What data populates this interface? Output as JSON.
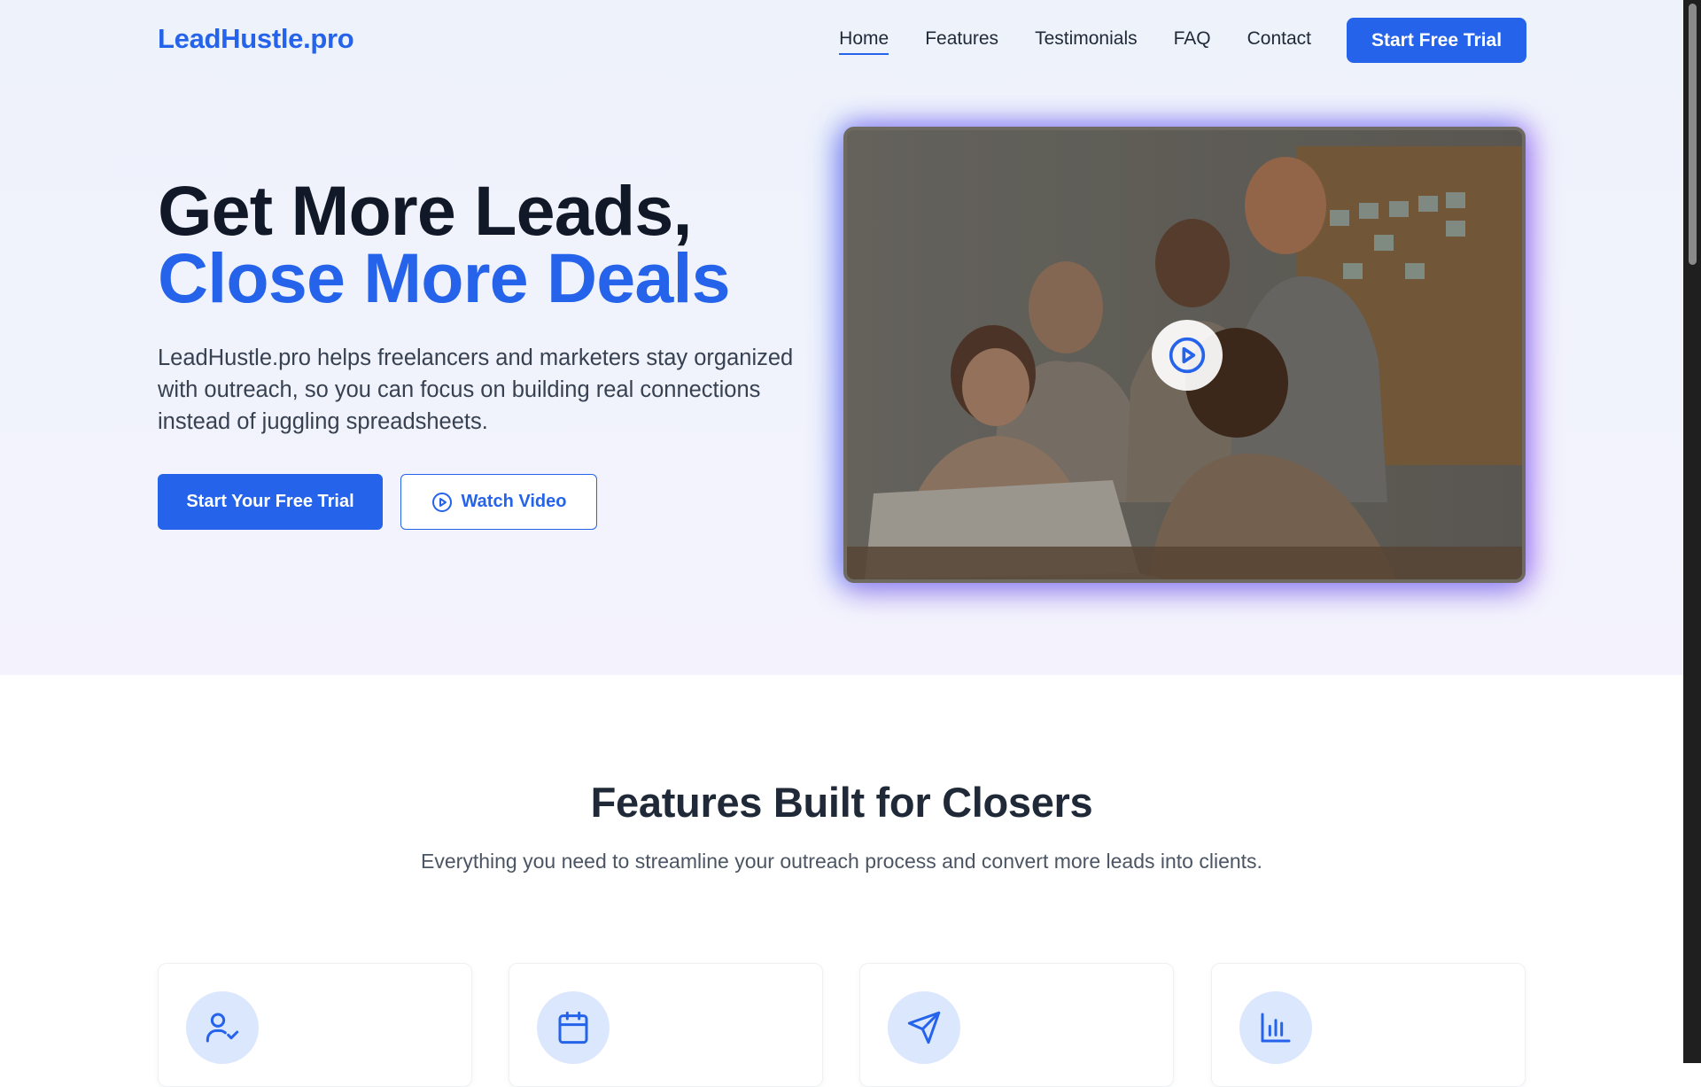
{
  "brand": {
    "logo": "LeadHustle.pro",
    "accent": "#2563eb",
    "text_dark": "#111827"
  },
  "nav": {
    "links": [
      {
        "label": "Home",
        "active": true
      },
      {
        "label": "Features",
        "active": false
      },
      {
        "label": "Testimonials",
        "active": false
      },
      {
        "label": "FAQ",
        "active": false
      },
      {
        "label": "Contact",
        "active": false
      }
    ],
    "cta_label": "Start Free Trial"
  },
  "hero": {
    "title_line1": "Get More Leads,",
    "title_line2": "Close More Deals",
    "subtitle": "LeadHustle.pro helps freelancers and marketers stay organized with outreach, so you can focus on building real connections instead of juggling spreadsheets.",
    "primary_button": "Start Your Free Trial",
    "secondary_button": "Watch Video",
    "video_icon": "play-circle-icon"
  },
  "features": {
    "title": "Features Built for Closers",
    "subtitle": "Everything you need to streamline your outreach process and convert more leads into clients.",
    "cards": [
      {
        "icon": "user-check-icon"
      },
      {
        "icon": "calendar-icon"
      },
      {
        "icon": "send-icon"
      },
      {
        "icon": "bar-chart-icon"
      }
    ]
  }
}
